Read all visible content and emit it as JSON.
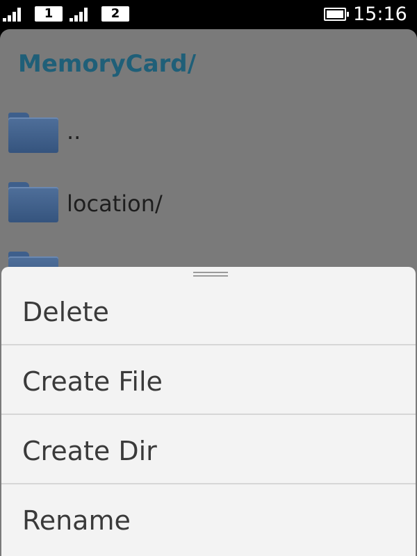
{
  "status_bar": {
    "sim1": "1",
    "sim2": "2",
    "time": "15:16",
    "battery_level": 1.0
  },
  "file_browser": {
    "path": "MemoryCard/",
    "entries": [
      {
        "name": "..",
        "icon": "folder-icon"
      },
      {
        "name": "location/",
        "icon": "folder-icon"
      },
      {
        "name": "",
        "icon": "folder-icon"
      }
    ]
  },
  "menu": {
    "items": [
      {
        "label": "Delete"
      },
      {
        "label": "Create File"
      },
      {
        "label": "Create Dir"
      },
      {
        "label": "Rename"
      }
    ]
  }
}
